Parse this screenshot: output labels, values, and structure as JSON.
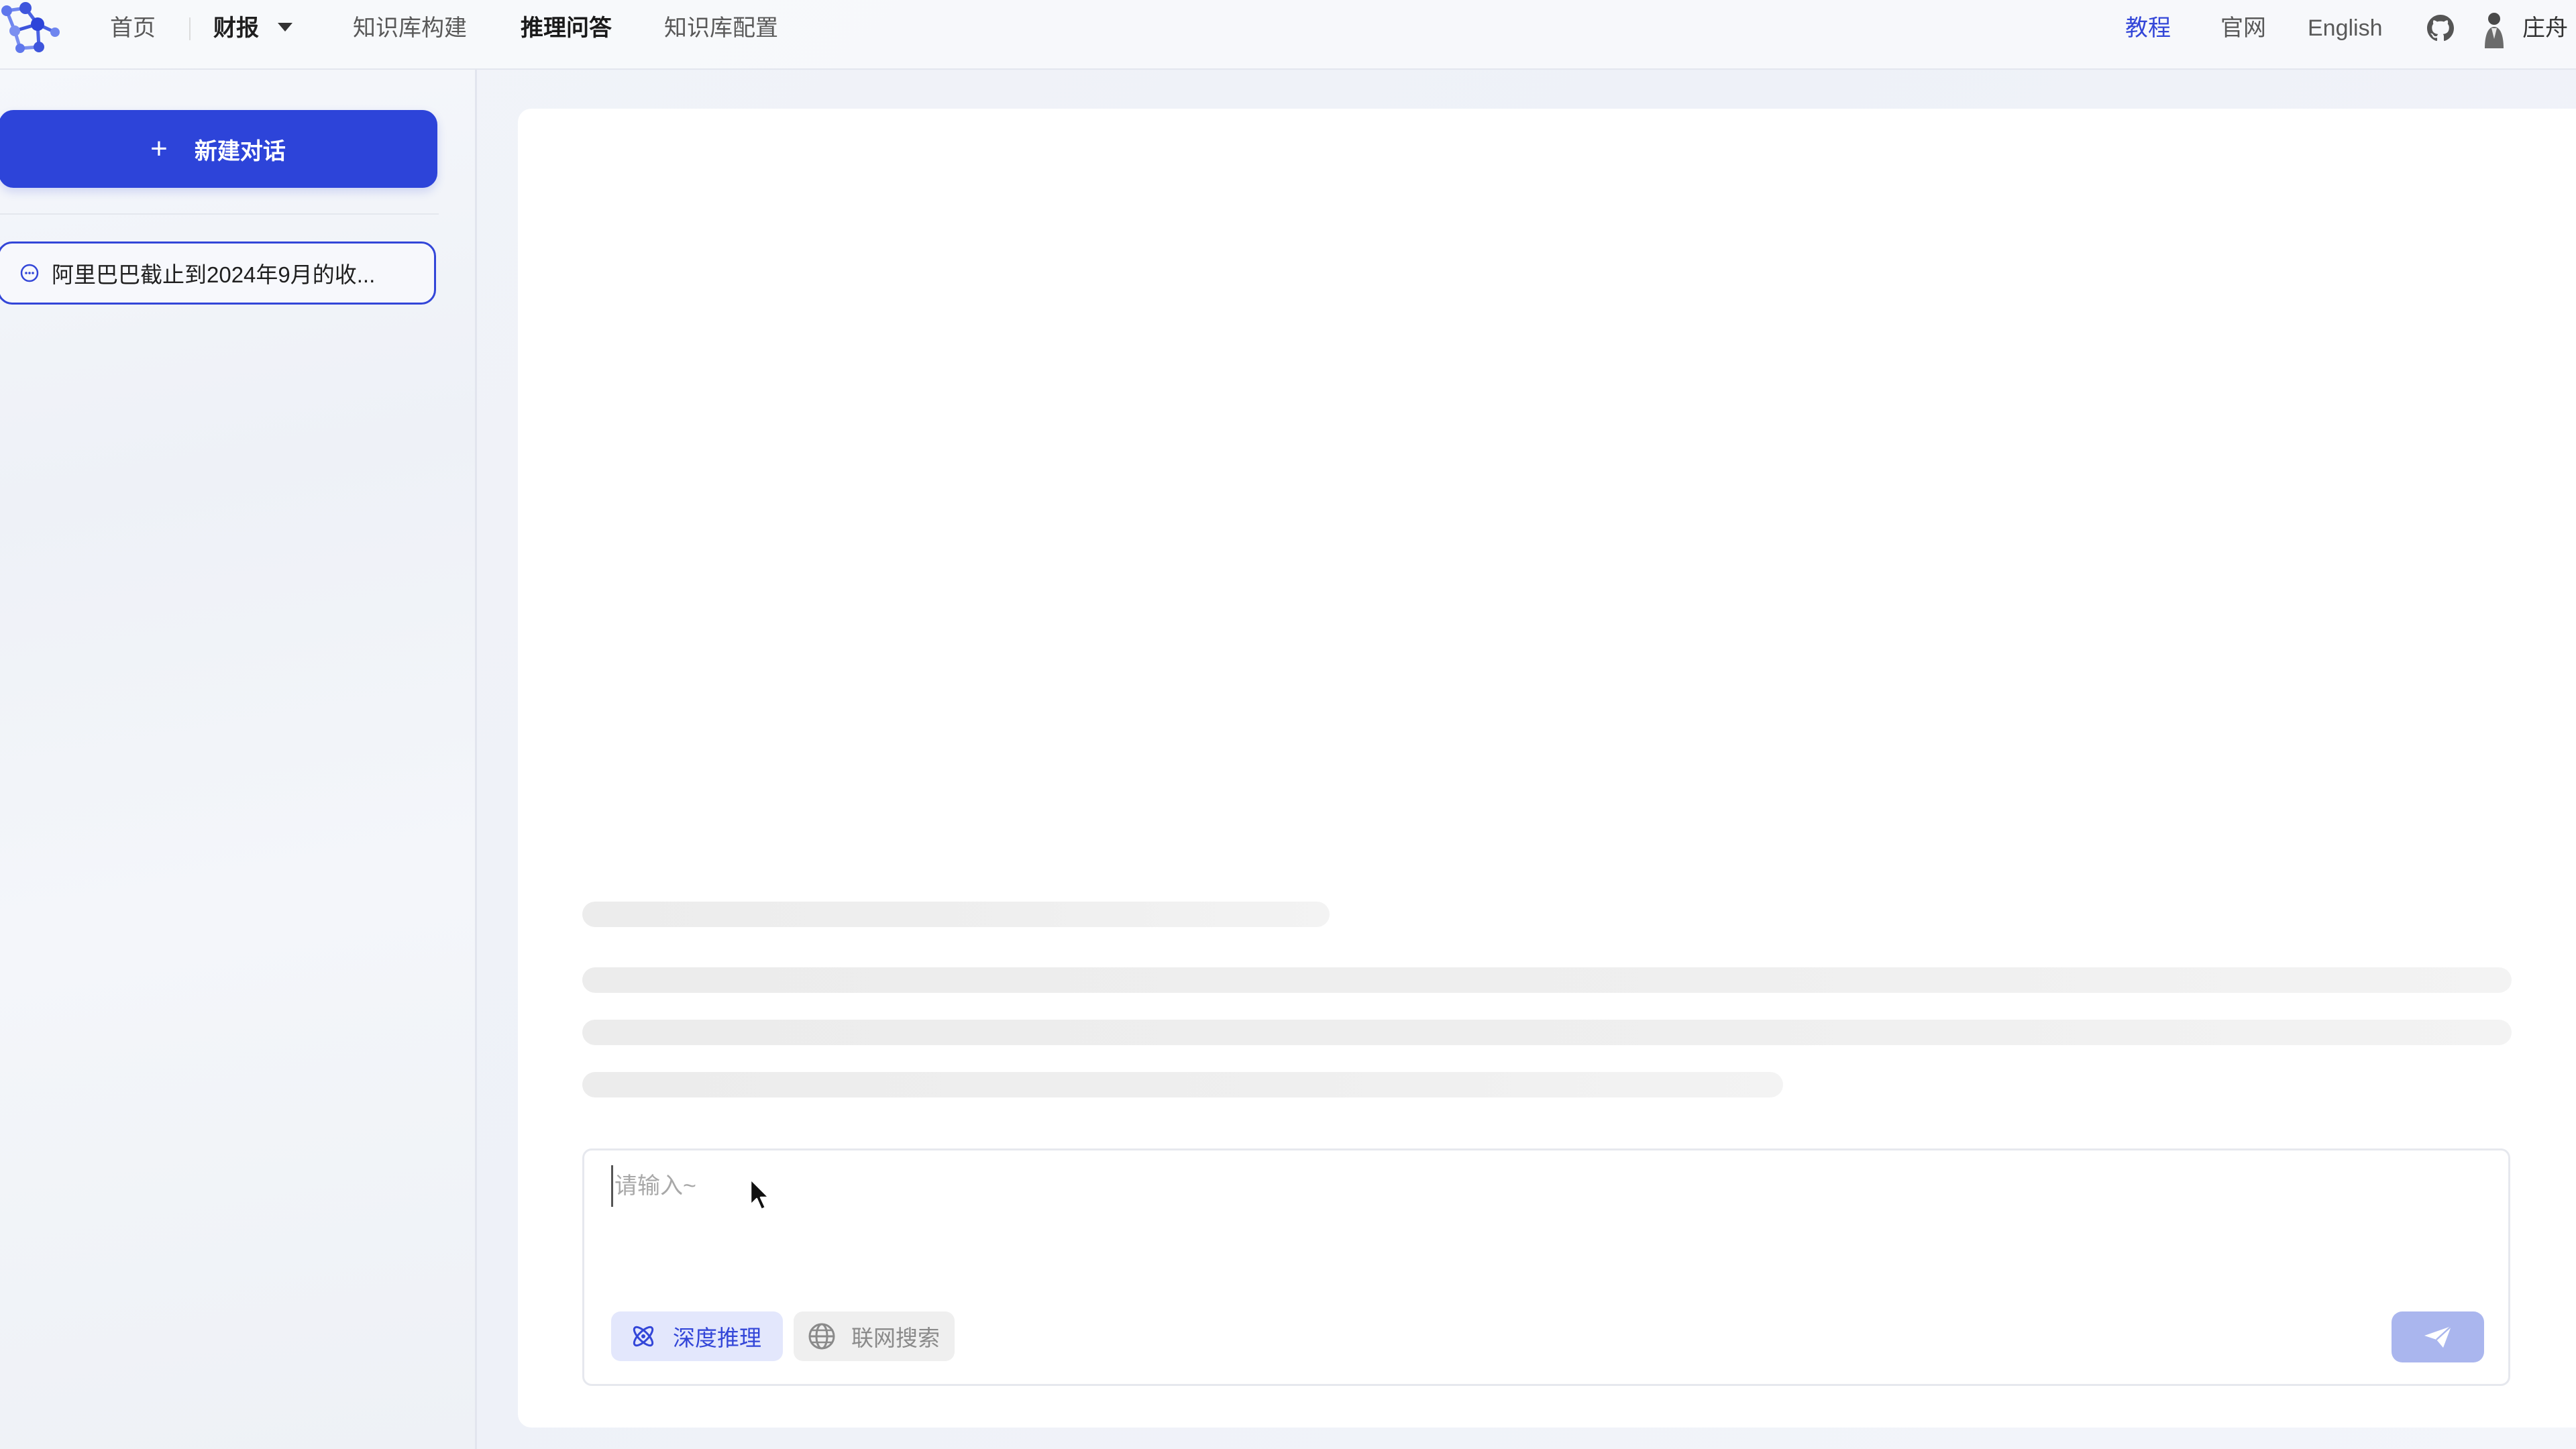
{
  "nav": {
    "home": "首页",
    "reports": "财报",
    "kb_build": "知识库构建",
    "reasoning_qa": "推理问答",
    "kb_config": "知识库配置",
    "tutorial": "教程",
    "official_site": "官网",
    "language": "English",
    "user_name": "庄舟",
    "icons": [
      "app-logo-icon",
      "chevron-down-icon",
      "github-icon",
      "avatar"
    ],
    "accent_color": "#3346d8"
  },
  "sidebar": {
    "new_chat_label": "新建对话",
    "conversations": [
      {
        "title": "阿里巴巴截止到2024年9月的收..."
      }
    ],
    "accent_color": "#2d44d9"
  },
  "chat": {
    "loading_placeholder_lines": 4,
    "input_placeholder": "请输入~",
    "input_value": "",
    "deep_reasoning_label": "深度推理",
    "deep_reasoning_active": true,
    "web_search_label": "联网搜索",
    "web_search_active": false,
    "send_enabled": false,
    "icons": [
      "atom-icon",
      "globe-icon",
      "send-icon",
      "mouse-cursor-icon"
    ]
  }
}
